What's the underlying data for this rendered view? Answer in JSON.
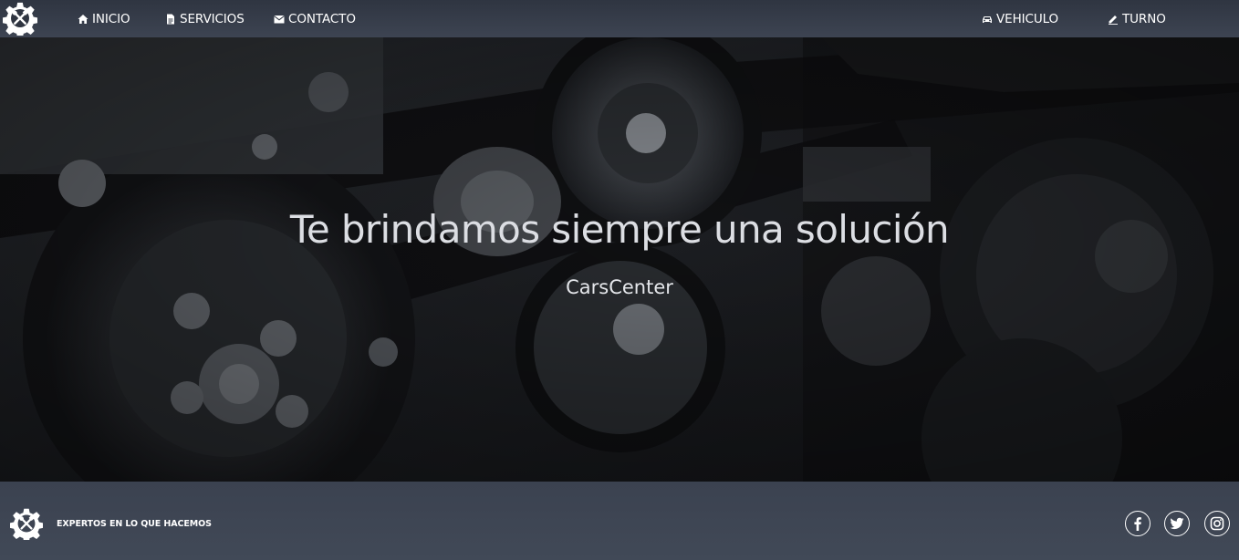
{
  "navbar": {
    "brand_icon": "gear-tools-icon",
    "left_links": [
      {
        "label": "INICIO",
        "icon": "home-icon"
      },
      {
        "label": "SERVICIOS",
        "icon": "document-icon"
      },
      {
        "label": "CONTACTO",
        "icon": "mail-icon"
      }
    ],
    "right_links": [
      {
        "label": "VEHICULO",
        "icon": "car-icon"
      },
      {
        "label": "TURNO",
        "icon": "pencil-icon"
      }
    ]
  },
  "hero": {
    "background": "engine-photo",
    "title": "Te brindamos siempre una solución",
    "subtitle": "CarsCenter"
  },
  "footer": {
    "logo_icon": "gear-tools-icon",
    "tagline": "EXPERTOS EN LO QUE HACEMOS",
    "social": [
      {
        "name": "facebook",
        "icon": "facebook-icon"
      },
      {
        "name": "twitter",
        "icon": "twitter-icon"
      },
      {
        "name": "instagram",
        "icon": "instagram-icon"
      }
    ]
  },
  "colors": {
    "nav_bg": "#353b47",
    "footer_bg": "#3d4452",
    "text": "#ffffff",
    "hero_text": "#dcdee3"
  }
}
